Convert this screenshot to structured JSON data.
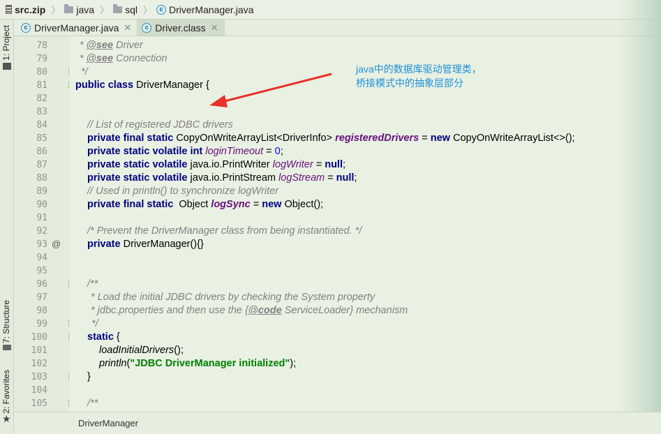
{
  "breadcrumb": [
    "src.zip",
    "java",
    "sql",
    "DriverManager.java"
  ],
  "tabs": [
    {
      "label": "DriverManager.java",
      "active": false
    },
    {
      "label": "Driver.class",
      "active": true
    }
  ],
  "toolstrip": {
    "project": "1: Project",
    "structure": "7: Structure",
    "favorites": "2: Favorites"
  },
  "gutter": {
    "line_numbers": [
      "78",
      "79",
      "80",
      "81",
      "82",
      "83",
      "84",
      "85",
      "86",
      "87",
      "88",
      "89",
      "90",
      "91",
      "92",
      "93",
      "94",
      "95",
      "96",
      "97",
      "98",
      "99",
      "100",
      "101",
      "102",
      "103",
      "104",
      "105"
    ],
    "override_marker": "@"
  },
  "code": {
    "l78_tag": "@see",
    "l78_rest": " Driver",
    "l79_tag": "@see",
    "l79_rest": " Connection",
    "l80": "*/",
    "l81_kw": "public class",
    "l81_rest": " DriverManager {",
    "l84": "// List of registered JDBC drivers",
    "l85_kw": "private final static",
    "l85_type": " CopyOnWriteArrayList<DriverInfo> ",
    "l85_field": "registeredDrivers",
    "l85_eq": " = ",
    "l85_new": "new",
    "l85_end": " CopyOnWriteArrayList<>();",
    "l86_kw": "private static volatile int",
    "l86_field": "loginTimeout",
    "l86_eq": " = ",
    "l86_num": "0",
    "l86_end": ";",
    "l87_kw": "private static volatile",
    "l87_type": " java.io.PrintWriter ",
    "l87_field": "logWriter",
    "l87_eq": " = ",
    "l87_null": "null",
    "l87_end": ";",
    "l88_kw": "private static volatile",
    "l88_type": " java.io.PrintStream ",
    "l88_field": "logStream",
    "l88_eq": " = ",
    "l88_null": "null",
    "l88_end": ";",
    "l89": "// Used in println() to synchronize logWriter",
    "l90_kw": "private final static",
    "l90_type": "  Object ",
    "l90_field": "logSync",
    "l90_eq": " = ",
    "l90_new": "new",
    "l90_end": " Object();",
    "l92": "/* Prevent the DriverManager class from being instantiated. */",
    "l93_kw": "private",
    "l93_rest": " DriverManager(){}",
    "l96": "/**",
    "l97": "* Load the initial JDBC drivers by checking the System property",
    "l98_a": "* jdbc.properties and then use the {",
    "l98_tag": "@code",
    "l98_b": " ServiceLoader} mechanism",
    "l99": "*/",
    "l100_kw": "static",
    "l100_rest": " {",
    "l101_call": "loadInitialDrivers",
    "l101_end": "();",
    "l102_call": "println",
    "l102_open": "(",
    "l102_str": "\"JDBC DriverManager initialized\"",
    "l102_end": ");",
    "l103": "}",
    "l105": "/**"
  },
  "annotation": {
    "line1": "java中的数据库驱动管理类，",
    "line2": "桥接模式中的抽象层部分",
    "color": "#1e90d6",
    "arrow_color": "#e8322a"
  },
  "status": {
    "text": "DriverManager"
  }
}
